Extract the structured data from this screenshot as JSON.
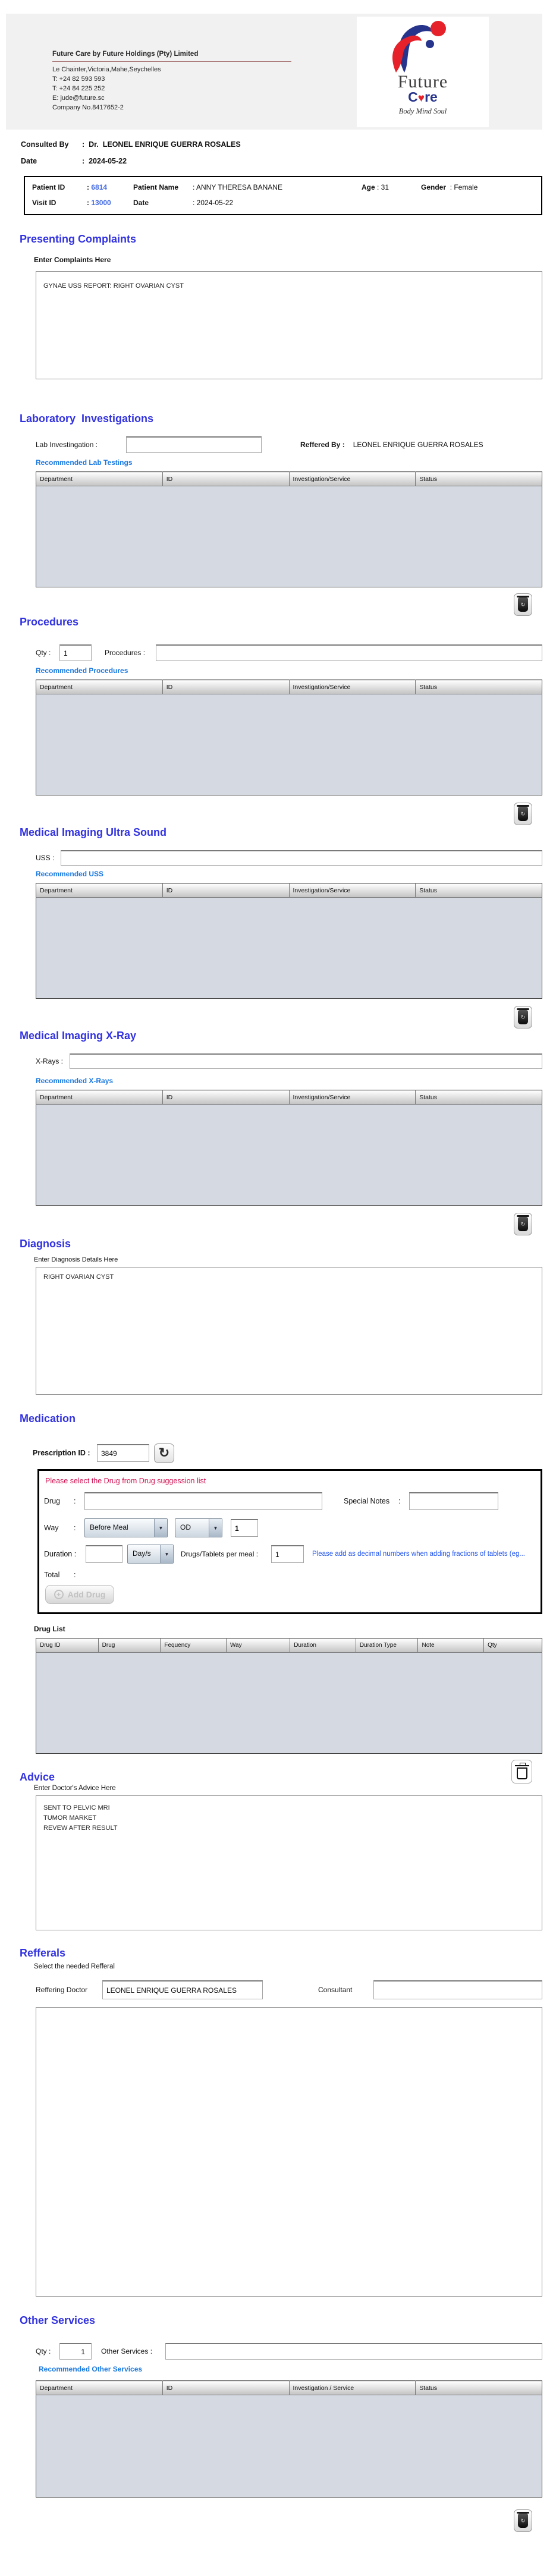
{
  "header": {
    "company_name": "Future Care by Future Holdings (Pty) Limited",
    "address": "Le Chainter,Victoria,Mahe,Seychelles",
    "phone1": "T: +24  82 593 593",
    "phone2": "T: +24  84 225 252",
    "email": "E: jude@future.sc",
    "company_no": "Company No.8417652-2",
    "logo_word1": "Future",
    "logo_word2_pre": "C",
    "logo_heart": "♥",
    "logo_word2_post": "re",
    "logo_tagline": "Body Mind Soul"
  },
  "consultation": {
    "consulted_by_label": "Consulted By",
    "consulted_by_value": ":  Dr.  LEONEL ENRIQUE GUERRA ROSALES",
    "date_label": "Date",
    "date_value": ":  2024-05-22"
  },
  "patient": {
    "patient_id_label": "Patient ID",
    "patient_id_colon": ":",
    "patient_id": "6814",
    "patient_name_label": "Patient Name",
    "patient_name": ": ANNY THERESA BANANE",
    "age_label": "Age",
    "age": ": 31",
    "gender_label": "Gender",
    "gender": ": Female",
    "visit_id_label": "Visit ID",
    "visit_id_colon": ":",
    "visit_id": "13000",
    "date_label": "Date",
    "date": ": 2024-05-22"
  },
  "tables": {
    "headers4": [
      "Department",
      "ID",
      "Investigation/Service",
      "Status"
    ],
    "headers4_other": [
      "Department",
      "ID",
      "Investigation / Service",
      "Status"
    ]
  },
  "presenting_complaints": {
    "title": "Presenting Complaints",
    "label": "Enter Complaints Here",
    "value": "GYNAE USS REPORT: RIGHT OVARIAN CYST"
  },
  "laboratory": {
    "title": "Laboratory  Investigations",
    "lab_label": "Lab Investingation :",
    "reffered_by_label": "Reffered By :",
    "reffered_by_value": "LEONEL ENRIQUE GUERRA ROSALES",
    "link": "Recommended Lab Testings"
  },
  "procedures": {
    "title": "Procedures",
    "qty_label": "Qty :",
    "qty_value": "1",
    "label": "Procedures :",
    "link": "Recommended Procedures"
  },
  "uss": {
    "title": "Medical Imaging Ultra Sound",
    "label": "USS :",
    "link": "Recommended USS"
  },
  "xray": {
    "title": "Medical Imaging X-Ray",
    "label": "X-Rays :",
    "link": "Recommended X-Rays"
  },
  "diagnosis": {
    "title": "Diagnosis",
    "label": "Enter Diagnosis Details Here",
    "value": "RIGHT OVARIAN CYST"
  },
  "medication": {
    "title": "Medication",
    "prescription_id_label": "Prescription ID :",
    "prescription_id": "3849",
    "warning": "Please select the Drug from Drug suggession list",
    "drug_label": "Drug",
    "drug_colon": ":",
    "special_notes_label": "Special Notes",
    "special_notes_colon": ":",
    "way_label": "Way",
    "way_colon": ":",
    "way_meal_option": "Before Meal",
    "way_freq_option": "OD",
    "way_qty": "1",
    "duration_label": "Duration :",
    "duration_unit_option": "Day/s",
    "per_meal_label": "Drugs/Tablets per meal :",
    "per_meal_value": "1",
    "fraction_note": "Please add as decimal numbers when adding fractions of tablets (eg...",
    "total_label": "Total",
    "total_colon": ":",
    "add_drug_label": "Add Drug",
    "drug_list_label": "Drug List",
    "drug_headers": [
      "Drug ID",
      "Drug",
      "Fequency",
      "Way",
      "Duration",
      "Duration Type",
      "Note",
      "Qty"
    ]
  },
  "advice": {
    "title": "Advice",
    "label": "Enter Doctor's Advice Here",
    "value": "SENT TO PELVIC MRI\nTUMOR MARKET\nREVEW AFTER RESULT"
  },
  "refferals": {
    "title": "Refferals",
    "subtitle": "Select the needed Refferal",
    "doctor_label": "Reffering Doctor",
    "doctor_value": "LEONEL ENRIQUE GUERRA ROSALES",
    "consultant_label": "Consultant"
  },
  "other_services": {
    "title": "Other Services",
    "qty_label": "Qty :",
    "qty_value": "1",
    "label": "Other Services :",
    "link": "Recommended Other Services"
  },
  "colors": {
    "section_heading": "#3232e0",
    "link_blue": "#1777e0",
    "id_blue": "#4169e1",
    "warning_red": "#d01050",
    "note_blue": "#2255ee",
    "table_body_bg": "#d4d9e2",
    "logo_blue": "#27348b",
    "logo_red": "#e62129"
  }
}
